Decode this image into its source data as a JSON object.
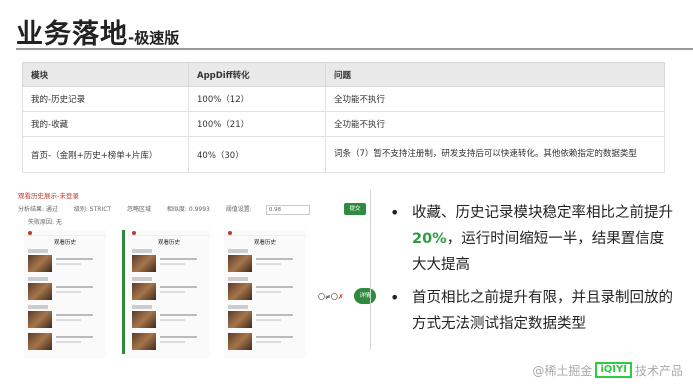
{
  "slide": {
    "title_main": "业务落地",
    "title_sub": "-极速版"
  },
  "table": {
    "headers": [
      "模块",
      "AppDiff转化",
      "问题"
    ],
    "rows": [
      [
        "我的-历史记录",
        "100%（12）",
        "全功能不执行"
      ],
      [
        "我的-收藏",
        "100%（21）",
        "全功能不执行"
      ],
      [
        "首页-（金刚+历史+榜单+片库）",
        "40%（30）",
        "词条（7）暂不支持注册制，研发支持后可以快速转化。其他依赖指定的数据类型"
      ]
    ]
  },
  "panel": {
    "header": "观看历史展示-未登录",
    "filter_result": "分析结果: 通过",
    "filter_level": "级别: STRICT",
    "filter_ignore": "忽略区域",
    "filter_similarity": "相似度: 0.9993",
    "threshold_label": "阈值设置:",
    "threshold_value": "0.98",
    "submit_label": "提交",
    "fail_label": "失败原因: 无",
    "phone_title": "观看历史",
    "compare_text": "〇≠〇",
    "compare_x": "✗",
    "detail_label": "详情"
  },
  "bullets": [
    {
      "pre": "收藏、历史记录模块稳定率相比之前提升",
      "highlight": "20%",
      "post": "，运行时间缩短一半，结果置信度大大提高"
    },
    {
      "pre": "首页相比之前提升有限，并且录制回放的方式无法测试指定数据类型",
      "highlight": "",
      "post": ""
    }
  ],
  "watermark": {
    "text": "@稀土掘金",
    "logo": "iQIYI",
    "suffix": "技术产品"
  },
  "colors": {
    "accent_green": "#2e9b3f",
    "alert_red": "#c0392b"
  }
}
